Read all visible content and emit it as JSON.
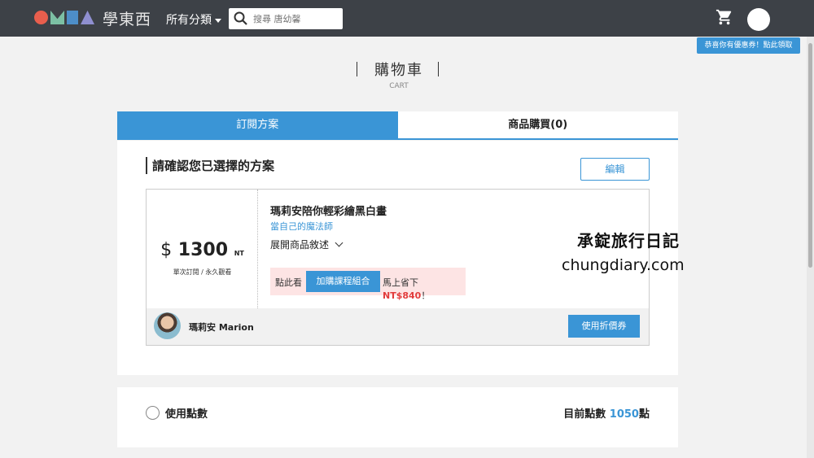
{
  "header": {
    "brand_text": "學東西",
    "category_menu": "所有分類",
    "search_placeholder": "搜尋 唐幼馨",
    "coupon_badge": "恭喜你有優惠券！點此領取"
  },
  "page": {
    "title": "購物車",
    "subtitle": "CART"
  },
  "tabs": [
    {
      "label": "訂閱方案"
    },
    {
      "label": "商品購買(0)"
    }
  ],
  "plan_section": {
    "title": "請確認您已選擇的方案",
    "edit_label": "編輯",
    "currency_symbol": "$",
    "price": "1300",
    "price_unit": "NT",
    "price_note": "單次訂閱 / 永久觀看",
    "course_title": "瑪莉安陪你輕彩繪黑白畫",
    "course_subtitle": "當自己的魔法師",
    "expand_label": "展開商品敘述",
    "promo_prefix": "點此看",
    "promo_button": "加購課程組合",
    "promo_suffix": "馬上省下",
    "promo_amount": "NT$840",
    "promo_end": "！",
    "teacher_name": "瑪莉安 Marion",
    "coupon_button": "使用折價券"
  },
  "watermark": {
    "line1": "承錠旅行日記",
    "line2": "chungdiary.com"
  },
  "points": {
    "label": "使用點數",
    "current_prefix": "目前點數",
    "current_value": "1050",
    "current_suffix": "點"
  },
  "colors": {
    "accent": "#3a95d6",
    "topbar": "#3d4147",
    "promo_bg": "#fde4e4",
    "promo_red": "#e23b3b"
  }
}
